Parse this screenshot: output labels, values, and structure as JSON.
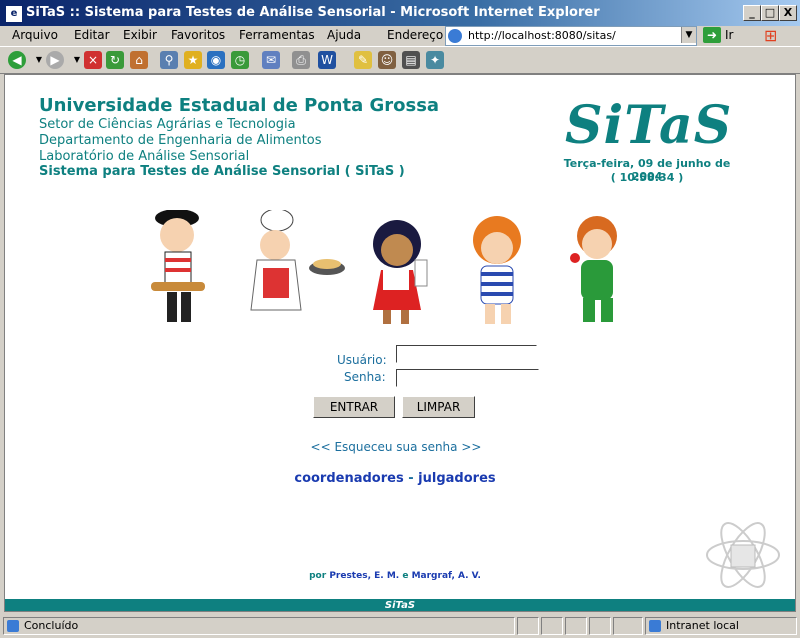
{
  "window": {
    "title": "SiTaS :: Sistema para Testes de Análise Sensorial - Microsoft Internet Explorer",
    "icon": "ie-page-icon",
    "buttons": {
      "minimize": "_",
      "maximize": "□",
      "close": "X"
    }
  },
  "menubar": {
    "items": [
      "Arquivo",
      "Editar",
      "Exibir",
      "Favoritos",
      "Ferramentas",
      "Ajuda"
    ],
    "address_label": "Endereço",
    "address_value": "http://localhost:8080/sitas/",
    "go_label": "Ir"
  },
  "toolbar": {
    "icons": [
      "back-icon",
      "forward-icon",
      "stop-icon",
      "refresh-icon",
      "home-icon",
      "search-icon",
      "favorites-icon",
      "media-icon",
      "history-icon",
      "mail-icon",
      "print-icon",
      "edit-icon",
      "discuss-icon",
      "messenger-icon",
      "research-icon",
      "other-icon"
    ]
  },
  "header": {
    "university": "Universidade Estadual de Ponta Grossa",
    "sector": "Setor de Ciências Agrárias e Tecnologia",
    "department": "Departamento de Engenharia de Alimentos",
    "lab": "Laboratório de Análise Sensorial",
    "system": "Sistema para Testes de Análise Sensorial ( SiTaS )",
    "logo": "SiTaS",
    "date": "Terça-feira, 09 de junho de 2004",
    "time": "( 10:58:34 )"
  },
  "login": {
    "user_label": "Usuário:",
    "password_label": "Senha:",
    "user_value": "",
    "password_value": "",
    "enter_button": "ENTRAR",
    "clear_button": "LIMPAR",
    "forgot_link": "<< Esqueceu sua senha >>"
  },
  "roles": {
    "coordinators": "coordenadores",
    "separator": "-",
    "judges": "julgadores"
  },
  "credits": {
    "prefix": "por",
    "author1": "Prestes, E. M.",
    "joiner": "e",
    "author2": "Margraf, A. V."
  },
  "footer": {
    "label": "SiTaS"
  },
  "statusbar": {
    "status": "Concluído",
    "zone": "Intranet local"
  },
  "colors": {
    "brand": "#0e8080",
    "link": "#1a3bb0",
    "label": "#1c6f9e"
  }
}
